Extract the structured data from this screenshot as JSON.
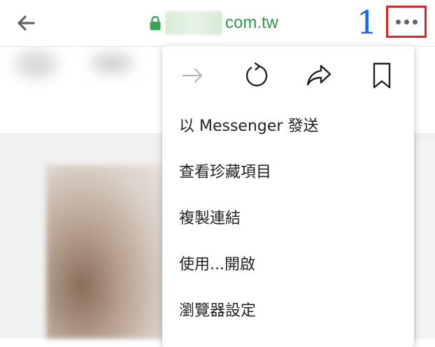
{
  "address_bar": {
    "url_visible": "com.tw",
    "icons": {
      "back": "arrow-left-icon",
      "lock": "lock-icon",
      "more": "more-horiz-icon"
    },
    "colors": {
      "url": "#2e9a43",
      "lock": "#34a853"
    }
  },
  "annotation": {
    "step_number": "1",
    "color": "#1565ff",
    "highlight_color": "#e02020"
  },
  "menu": {
    "action_icons": [
      "forward-icon",
      "reload-icon",
      "share-icon",
      "bookmark-icon"
    ],
    "items": [
      {
        "label": "以 Messenger 發送"
      },
      {
        "label": "查看珍藏項目"
      },
      {
        "label": "複製連結"
      },
      {
        "label": "使用...開啟"
      },
      {
        "label": "瀏覽器設定"
      }
    ]
  }
}
